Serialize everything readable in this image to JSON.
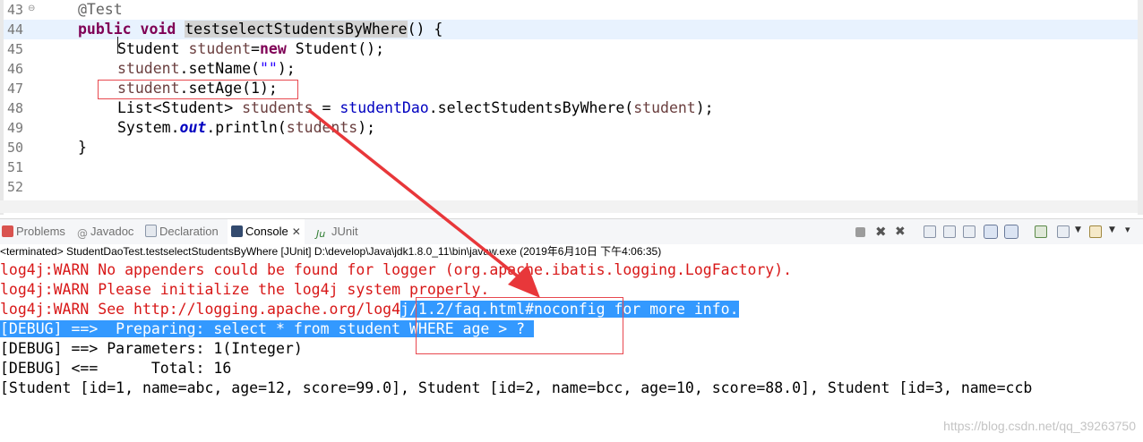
{
  "editor": {
    "lines": [
      {
        "num": "43",
        "fold": "⊖"
      },
      {
        "num": "44"
      },
      {
        "num": "45"
      },
      {
        "num": "46"
      },
      {
        "num": "47"
      },
      {
        "num": "48"
      },
      {
        "num": "49"
      },
      {
        "num": "50"
      },
      {
        "num": "51"
      },
      {
        "num": "52"
      }
    ],
    "code": {
      "l43": {
        "annotation": "@Test"
      },
      "l44": {
        "kw1": "public",
        "kw2": "void",
        "method": "testselectStudentsByWhere",
        "rest": "() {"
      },
      "l45": {
        "type": "Student",
        "var": "student",
        "eq": "=",
        "kw": "new",
        "rest": " Student();"
      },
      "l46": {
        "var": "student",
        "call": ".setName(",
        "str": "\"\"",
        "end": ");"
      },
      "l47": {
        "var": "student",
        "call": ".setAge(1);"
      },
      "l48": {
        "type": "List<Student> ",
        "var": "students",
        "eq": " = ",
        "field": "studentDao",
        "call": ".selectStudentsByWhere(",
        "arg": "student",
        "end": ");"
      },
      "l49": {
        "cls": "System.",
        "field": "out",
        "call": ".println(",
        "arg": "students",
        "end": ");"
      },
      "l50": {
        "text": "}"
      }
    }
  },
  "views": {
    "tabs": [
      {
        "label": "Problems",
        "icon": "problems-icon"
      },
      {
        "label": "Javadoc",
        "icon": "javadoc-icon"
      },
      {
        "label": "Declaration",
        "icon": "declaration-icon"
      },
      {
        "label": "Console",
        "icon": "console-icon",
        "close": "✕",
        "active": true
      },
      {
        "label": "JUnit",
        "icon": "junit-icon"
      }
    ]
  },
  "console": {
    "header": "<terminated> StudentDaoTest.testselectStudentsByWhere [JUnit] D:\\develop\\Java\\jdk1.8.0_11\\bin\\javaw.exe (2019年6月10日 下午4:06:35)",
    "lines": [
      {
        "text": "log4j:WARN No appenders could be found for logger (org.apache.ibatis.logging.LogFactory)."
      },
      {
        "text": "log4j:WARN Please initialize the log4j system properly."
      },
      {
        "pre": "log4j:WARN See http://logging.apache.org/log4",
        "sel": "j/1.2/faq.html#noconfig for more info."
      },
      {
        "sel": "[DEBUG] ==>  Preparing: select * from student WHERE age > ? "
      },
      {
        "text": "[DEBUG] ==> Parameters: 1(Integer)"
      },
      {
        "text": "[DEBUG] <==      Total: 16"
      },
      {
        "text": "[Student [id=1, name=abc, age=12, score=99.0], Student [id=2, name=bcc, age=10, score=88.0], Student [id=3, name=ccb"
      }
    ]
  },
  "watermark": "https://blog.csdn.net/qq_39263750",
  "colors": {
    "keyword": "#7f0055",
    "field": "#0000c0",
    "variable": "#6a3e3e",
    "error": "#d81818",
    "selection": "#3399ff",
    "annotation_red": "#e8484f",
    "arrow": "#e8373a"
  }
}
